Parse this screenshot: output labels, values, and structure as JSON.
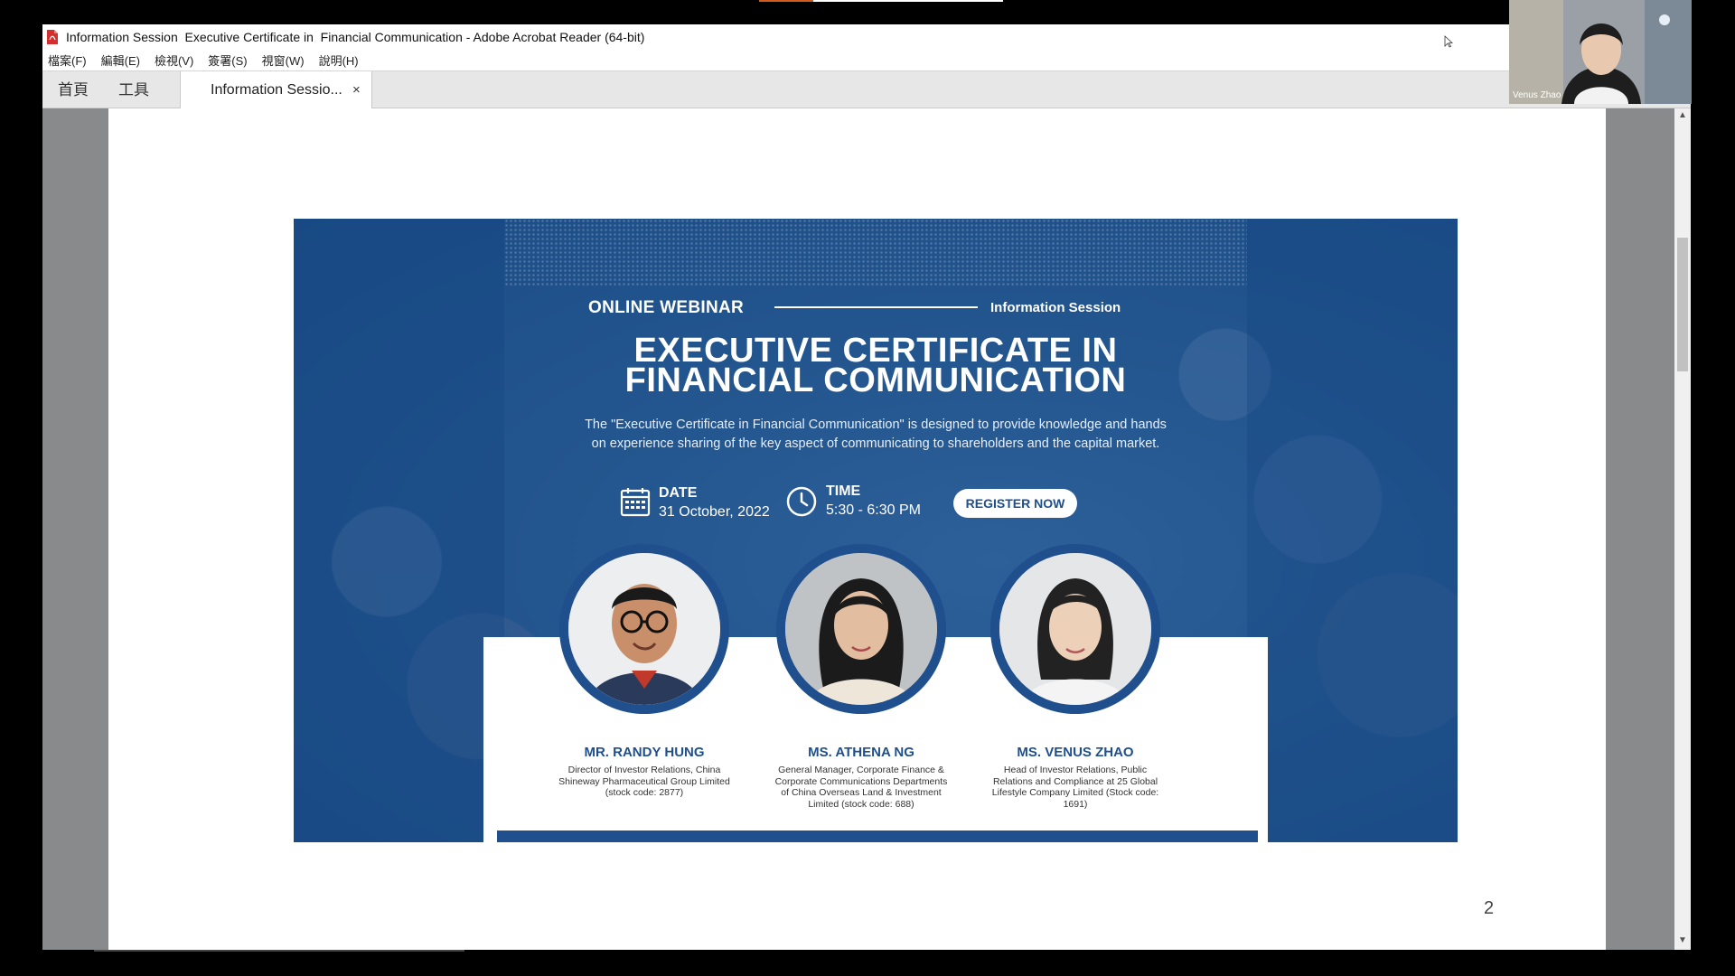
{
  "window": {
    "title": "Information Session  Executive Certificate in  Financial Communication - Adobe Acrobat Reader (64-bit)"
  },
  "menu": {
    "items": [
      {
        "label": "檔案(F)"
      },
      {
        "label": "編輯(E)"
      },
      {
        "label": "檢視(V)"
      },
      {
        "label": "簽署(S)"
      },
      {
        "label": "視窗(W)"
      },
      {
        "label": "說明(H)"
      }
    ]
  },
  "tabs": {
    "home": "首頁",
    "tools": "工具",
    "document": "Information Sessio...",
    "close": "×"
  },
  "scrollbar": {
    "up": "▲",
    "down": "▼"
  },
  "page_number": "2",
  "flyer": {
    "webinar_label": "ONLINE WEBINAR",
    "session_label": "Information Session",
    "title_line1": "EXECUTIVE CERTIFICATE IN",
    "title_line2": "FINANCIAL COMMUNICATION",
    "description": "The \"Executive Certificate in Financial Communication\" is designed to provide knowledge and hands on experience sharing of the key aspect of communicating to shareholders and the capital market.",
    "date_label": "DATE",
    "date_value": "31 October, 2022",
    "time_label": "TIME",
    "time_value": "5:30 - 6:30 PM",
    "register_label": "REGISTER NOW",
    "speakers": [
      {
        "name": "MR. RANDY HUNG",
        "role": "Director of Investor Relations, China Shineway Pharmaceutical Group Limited (stock code: 2877)"
      },
      {
        "name": "MS. ATHENA NG",
        "role": "General Manager, Corporate Finance & Corporate Communications Departments of China Overseas Land & Investment Limited (stock code: 688)"
      },
      {
        "name": "MS. VENUS ZHAO",
        "role": "Head of Investor Relations, Public Relations and Compliance at 25 Global Lifestyle Company Limited (Stock code: 1691)"
      }
    ]
  },
  "video": {
    "participant_name": "Venus Zhao"
  },
  "colors": {
    "flyer_blue": "#1f4f8c",
    "pdf_red": "#d32f2f"
  },
  "icons": {
    "pdf": "pdf-icon",
    "calendar": "calendar-icon",
    "clock": "clock-icon",
    "cursor": "cursor-icon"
  }
}
